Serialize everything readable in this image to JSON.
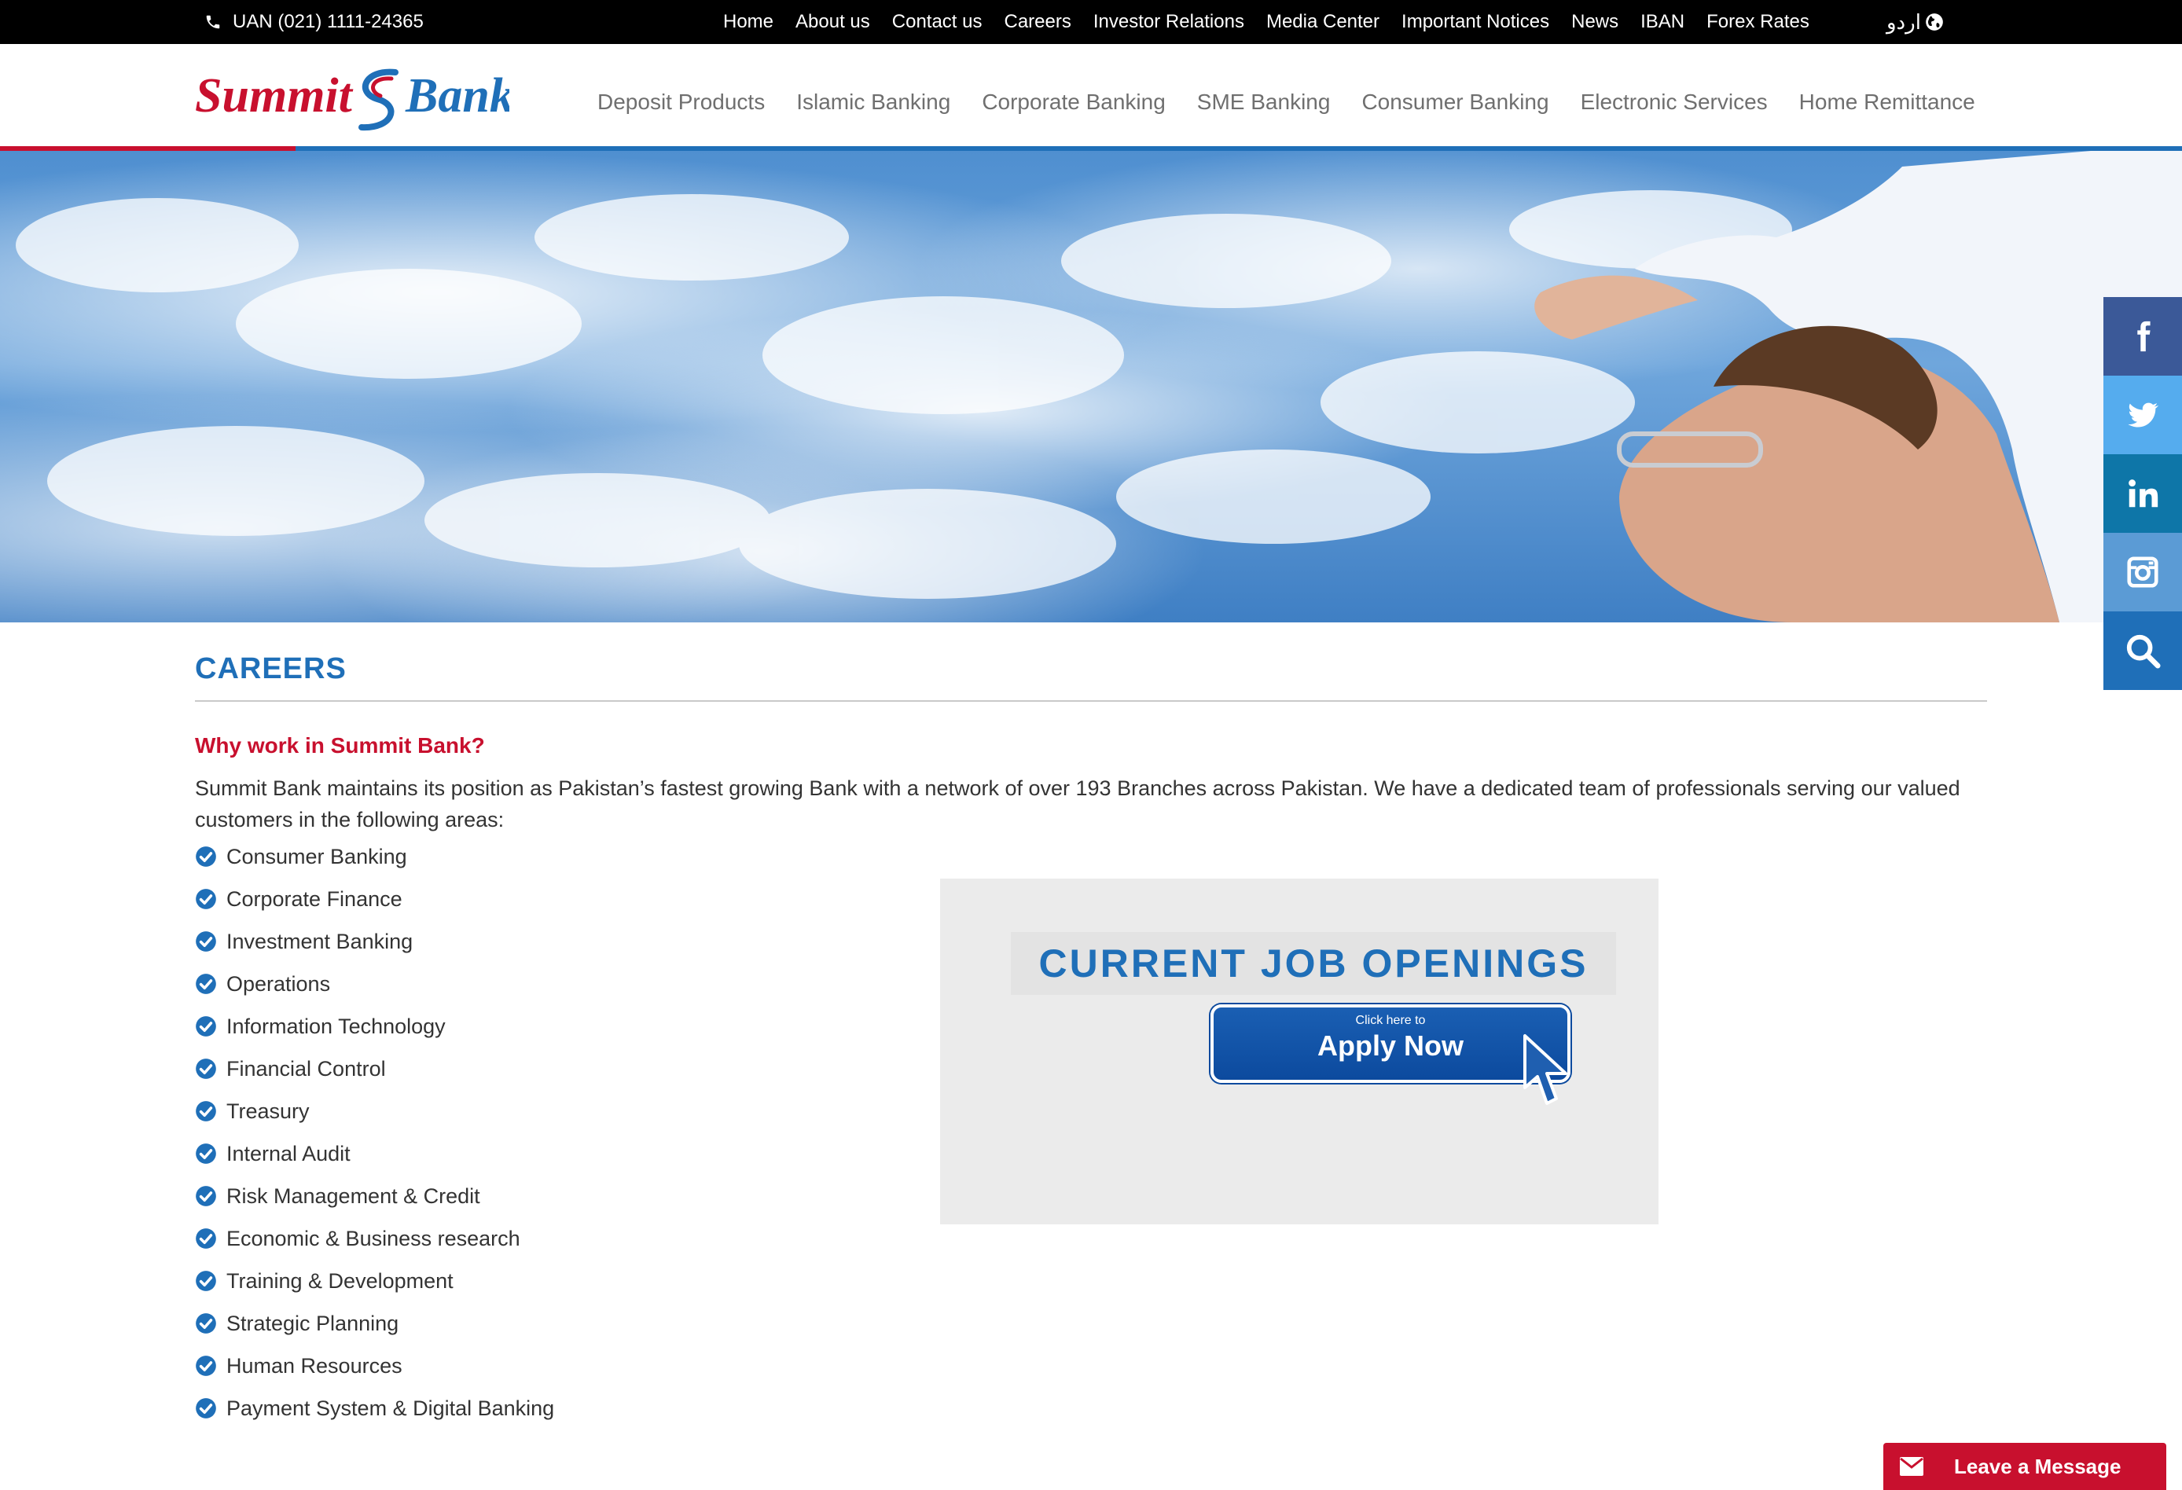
{
  "topbar": {
    "uan": "UAN (021) 1111-24365",
    "links": [
      "Home",
      "About us",
      "Contact us",
      "Careers",
      "Investor Relations",
      "Media Center",
      "Important Notices",
      "News",
      "IBAN",
      "Forex Rates"
    ],
    "language": "اردو"
  },
  "brand": {
    "logo_text_1": "Summit",
    "logo_text_2": "Bank",
    "red": "#c8102e",
    "blue": "#1f6fb8"
  },
  "nav": {
    "items": [
      "Deposit Products",
      "Islamic Banking",
      "Corporate Banking",
      "SME Banking",
      "Consumer Banking",
      "Electronic Services",
      "Home Remittance"
    ]
  },
  "social": {
    "items": [
      {
        "icon": "facebook-icon",
        "color": "#3b5998"
      },
      {
        "icon": "twitter-icon",
        "color": "#55acee"
      },
      {
        "icon": "linkedin-icon",
        "color": "#0e76a8"
      },
      {
        "icon": "instagram-icon",
        "color": "#5b9bd5"
      },
      {
        "icon": "search-icon",
        "color": "#1f6fb8"
      }
    ]
  },
  "main": {
    "title": "CAREERS",
    "subheading": "Why work in Summit Bank?",
    "intro": "Summit Bank maintains its position as Pakistan’s fastest growing Bank with a network of over 193 Branches across Pakistan. We have a dedicated team of professionals serving our valued customers in the following areas:",
    "areas": [
      "Consumer Banking",
      "Corporate Finance",
      "Investment Banking",
      "Operations",
      "Information Technology",
      "Financial Control",
      "Treasury",
      "Internal Audit",
      "Risk Management & Credit",
      "Economic & Business research",
      "Training & Development",
      "Strategic Planning",
      "Human Resources",
      "Payment System & Digital Banking"
    ]
  },
  "jobs": {
    "heading": "CURRENT JOB OPENINGS",
    "button_small": "Click here to",
    "button_big": "Apply Now"
  },
  "chat": {
    "label": "Leave a Message"
  }
}
